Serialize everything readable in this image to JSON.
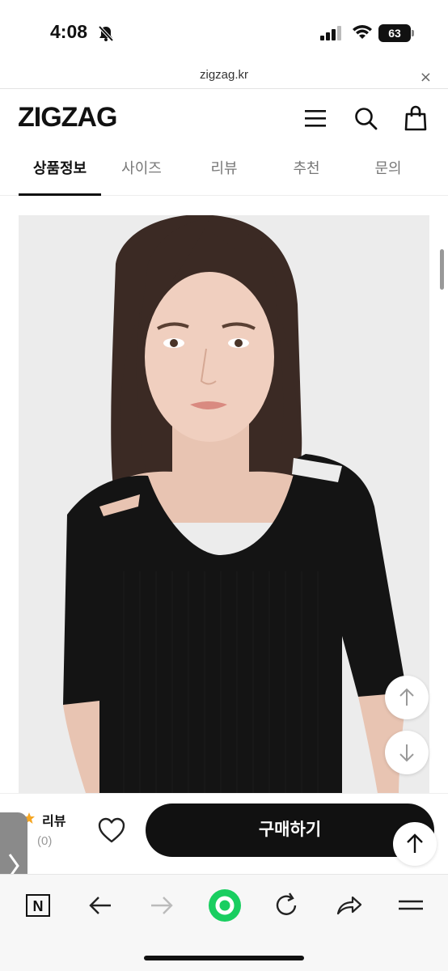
{
  "status_bar": {
    "time": "4:08",
    "battery": "63"
  },
  "browser": {
    "url": "zigzag.kr",
    "close_glyph": "×"
  },
  "header": {
    "logo": "ZIGZAG",
    "icons": [
      "menu-icon",
      "search-icon",
      "bag-icon"
    ]
  },
  "tabs": [
    {
      "label": "상품정보",
      "active": true
    },
    {
      "label": "사이즈",
      "active": false
    },
    {
      "label": "리뷰",
      "active": false
    },
    {
      "label": "추천",
      "active": false
    },
    {
      "label": "문의",
      "active": false
    }
  ],
  "product": {
    "image": "model-black-knit-top-photo"
  },
  "purchase_bar": {
    "review_label": "리뷰",
    "review_count": "(0)",
    "buy_label": "구매하기"
  },
  "toolbar": {
    "naver_label": "N"
  },
  "colors": {
    "accent_black": "#111111",
    "star": "#f5a623",
    "home_green": "#19ce60"
  }
}
